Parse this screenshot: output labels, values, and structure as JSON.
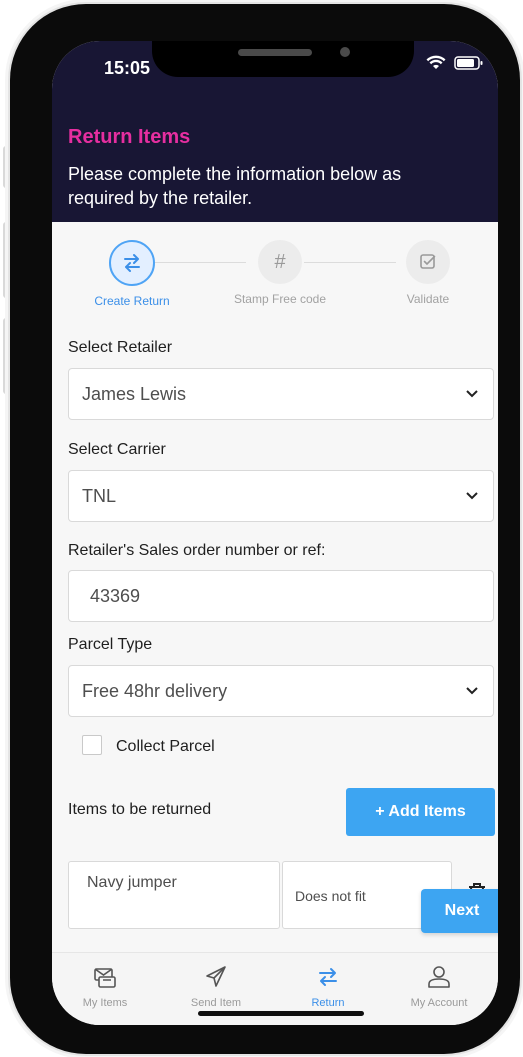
{
  "status_bar": {
    "time": "15:05"
  },
  "header": {
    "title": "Return Items",
    "subtitle": "Please complete the information below as required by the retailer."
  },
  "stepper": {
    "steps": [
      {
        "label": "Create Return",
        "icon": "swap-icon",
        "active": true
      },
      {
        "label": "Stamp Free code",
        "icon": "hash-icon",
        "active": false
      },
      {
        "label": "Validate",
        "icon": "checkbox-check-icon",
        "active": false
      }
    ]
  },
  "form": {
    "retailer": {
      "label": "Select Retailer",
      "value": "James Lewis"
    },
    "carrier": {
      "label": "Select Carrier",
      "value": "TNL"
    },
    "order_ref": {
      "label": "Retailer's Sales order number or ref:",
      "value": "43369"
    },
    "parcel_type": {
      "label": "Parcel Type",
      "value": "Free 48hr delivery"
    },
    "collect_parcel": {
      "label": "Collect Parcel",
      "checked": false
    }
  },
  "items": {
    "label": "Items to be returned",
    "add_button": "+ Add Items",
    "rows": [
      {
        "name": "Navy jumper",
        "reason": "Does not fit"
      }
    ]
  },
  "next_button": "Next",
  "tabbar": {
    "tabs": [
      {
        "label": "My Items",
        "icon": "items-icon",
        "active": false
      },
      {
        "label": "Send Item",
        "icon": "paper-plane-icon",
        "active": false
      },
      {
        "label": "Return",
        "icon": "return-icon",
        "active": true
      },
      {
        "label": "My Account",
        "icon": "user-icon",
        "active": false
      }
    ]
  },
  "colors": {
    "header_bg": "#181634",
    "title_accent": "#e62ea0",
    "primary": "#3da5f2",
    "active_tab": "#3b8fe8"
  }
}
